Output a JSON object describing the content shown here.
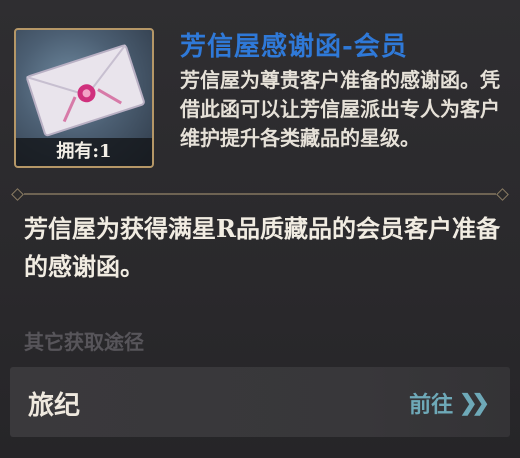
{
  "item": {
    "title": "芳信屋感谢函-会员",
    "description": "芳信屋为尊贵客户准备的感谢函。凭借此函可以让芳信屋派出专人为客户维护提升各类藏品的星级。",
    "count_label": "拥有:1",
    "detail": "芳信屋为获得满星R品质藏品的会员客户准备的感谢函。"
  },
  "sources": {
    "section_label": "其它获取途径",
    "entries": [
      {
        "name": "旅纪",
        "action": "前往"
      }
    ]
  },
  "colors": {
    "title": "#2f79d8",
    "goto": "#6ea9b8",
    "frame": "#b59767"
  },
  "icons": {
    "goto": "double-chevron-right-icon",
    "item": "envelope-letter-icon"
  }
}
